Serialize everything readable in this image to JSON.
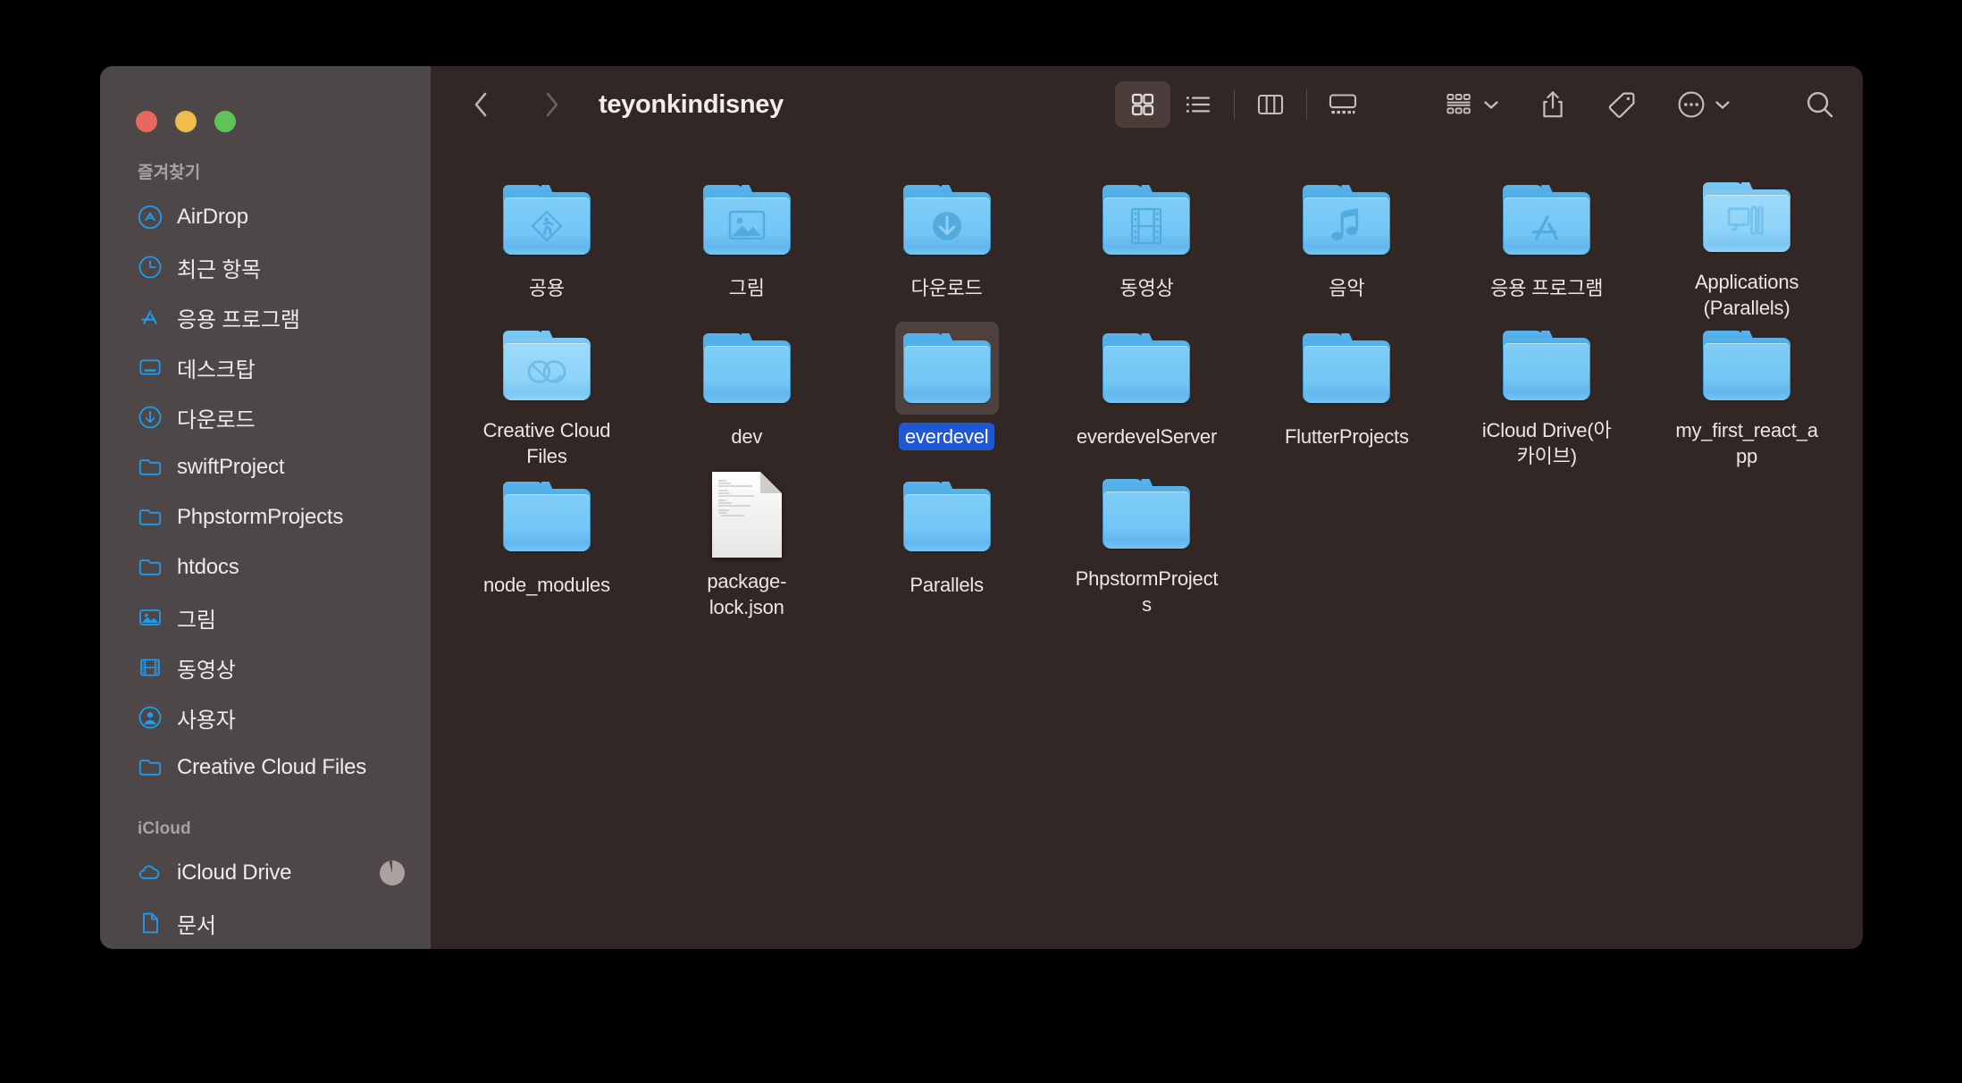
{
  "window": {
    "title": "teyonkindisney",
    "traffic_lights": [
      {
        "name": "close",
        "color": "#e8685d"
      },
      {
        "name": "minimize",
        "color": "#f0bc4e"
      },
      {
        "name": "maximize",
        "color": "#5ec45a"
      }
    ]
  },
  "toolbar": {
    "back_label": "Back",
    "forward_label": "Forward",
    "view_modes": [
      {
        "id": "icon",
        "label": "Icon View",
        "icon": "grid-icon",
        "active": true
      },
      {
        "id": "list",
        "label": "List View",
        "icon": "list-icon",
        "active": false
      },
      {
        "id": "column",
        "label": "Column View",
        "icon": "columns-icon",
        "active": false
      },
      {
        "id": "gallery",
        "label": "Gallery View",
        "icon": "gallery-icon",
        "active": false
      }
    ],
    "actions": [
      {
        "id": "group",
        "label": "Group Items",
        "icon": "group-icon",
        "has_chevron": true
      },
      {
        "id": "share",
        "label": "Share",
        "icon": "share-icon",
        "has_chevron": false
      },
      {
        "id": "tags",
        "label": "Tags",
        "icon": "tag-icon",
        "has_chevron": false
      },
      {
        "id": "more",
        "label": "More",
        "icon": "ellipsis-circle-icon",
        "has_chevron": true
      },
      {
        "id": "search",
        "label": "Search",
        "icon": "search-icon",
        "has_chevron": false
      }
    ]
  },
  "sidebar": {
    "sections": [
      {
        "title": "즐겨찾기",
        "items": [
          {
            "label": "AirDrop",
            "icon": "airdrop-icon"
          },
          {
            "label": "최근 항목",
            "icon": "clock-icon"
          },
          {
            "label": "응용 프로그램",
            "icon": "appstore-icon"
          },
          {
            "label": "데스크탑",
            "icon": "desktop-icon"
          },
          {
            "label": "다운로드",
            "icon": "download-circle-icon"
          },
          {
            "label": "swiftProject",
            "icon": "folder-icon"
          },
          {
            "label": "PhpstormProjects",
            "icon": "folder-icon"
          },
          {
            "label": "htdocs",
            "icon": "folder-icon"
          },
          {
            "label": "그림",
            "icon": "pictures-icon"
          },
          {
            "label": "동영상",
            "icon": "movies-icon"
          },
          {
            "label": "사용자",
            "icon": "user-icon"
          },
          {
            "label": "Creative Cloud Files",
            "icon": "folder-icon"
          }
        ]
      },
      {
        "title": "iCloud",
        "items": [
          {
            "label": "iCloud Drive",
            "icon": "cloud-icon",
            "badge": "sync-pie-badge"
          },
          {
            "label": "문서",
            "icon": "document-icon"
          }
        ]
      }
    ]
  },
  "files": [
    {
      "name": "공용",
      "icon": "folder-public",
      "type": "folder",
      "selected": false
    },
    {
      "name": "그림",
      "icon": "folder-pictures",
      "type": "folder",
      "selected": false
    },
    {
      "name": "다운로드",
      "icon": "folder-downloads",
      "type": "folder",
      "selected": false
    },
    {
      "name": "동영상",
      "icon": "folder-movies",
      "type": "folder",
      "selected": false
    },
    {
      "name": "음악",
      "icon": "folder-music",
      "type": "folder",
      "selected": false
    },
    {
      "name": "응용 프로그램",
      "icon": "folder-applications",
      "type": "folder",
      "selected": false
    },
    {
      "name": "Applications (Parallels)",
      "icon": "folder-parallels",
      "type": "folder",
      "selected": false
    },
    {
      "name": "Creative Cloud Files",
      "icon": "folder-creativecloud",
      "type": "folder",
      "selected": false
    },
    {
      "name": "dev",
      "icon": "folder-plain",
      "type": "folder",
      "selected": false
    },
    {
      "name": "everdevel",
      "icon": "folder-plain",
      "type": "folder",
      "selected": true
    },
    {
      "name": "everdevelServer",
      "icon": "folder-plain",
      "type": "folder",
      "selected": false
    },
    {
      "name": "FlutterProjects",
      "icon": "folder-plain",
      "type": "folder",
      "selected": false
    },
    {
      "name": "iCloud Drive(아카이브)",
      "icon": "folder-plain",
      "type": "folder",
      "selected": false
    },
    {
      "name": "my_first_react_app",
      "icon": "folder-plain",
      "type": "folder",
      "selected": false
    },
    {
      "name": "node_modules",
      "icon": "folder-plain",
      "type": "folder",
      "selected": false
    },
    {
      "name": "package-lock.json",
      "icon": "document-plain",
      "type": "document",
      "selected": false
    },
    {
      "name": "Parallels",
      "icon": "folder-plain",
      "type": "folder",
      "selected": false
    },
    {
      "name": "PhpstormProjects",
      "icon": "folder-plain",
      "type": "folder",
      "selected": false
    }
  ],
  "colors": {
    "sidebar_bg": "#4d4747",
    "content_bg": "#322724",
    "selection_blue": "#1f57d4",
    "accent_blue": "#1f9cf0",
    "folder_blue": "#73c6f5",
    "toolbar_icon": "#c8bdb9"
  }
}
